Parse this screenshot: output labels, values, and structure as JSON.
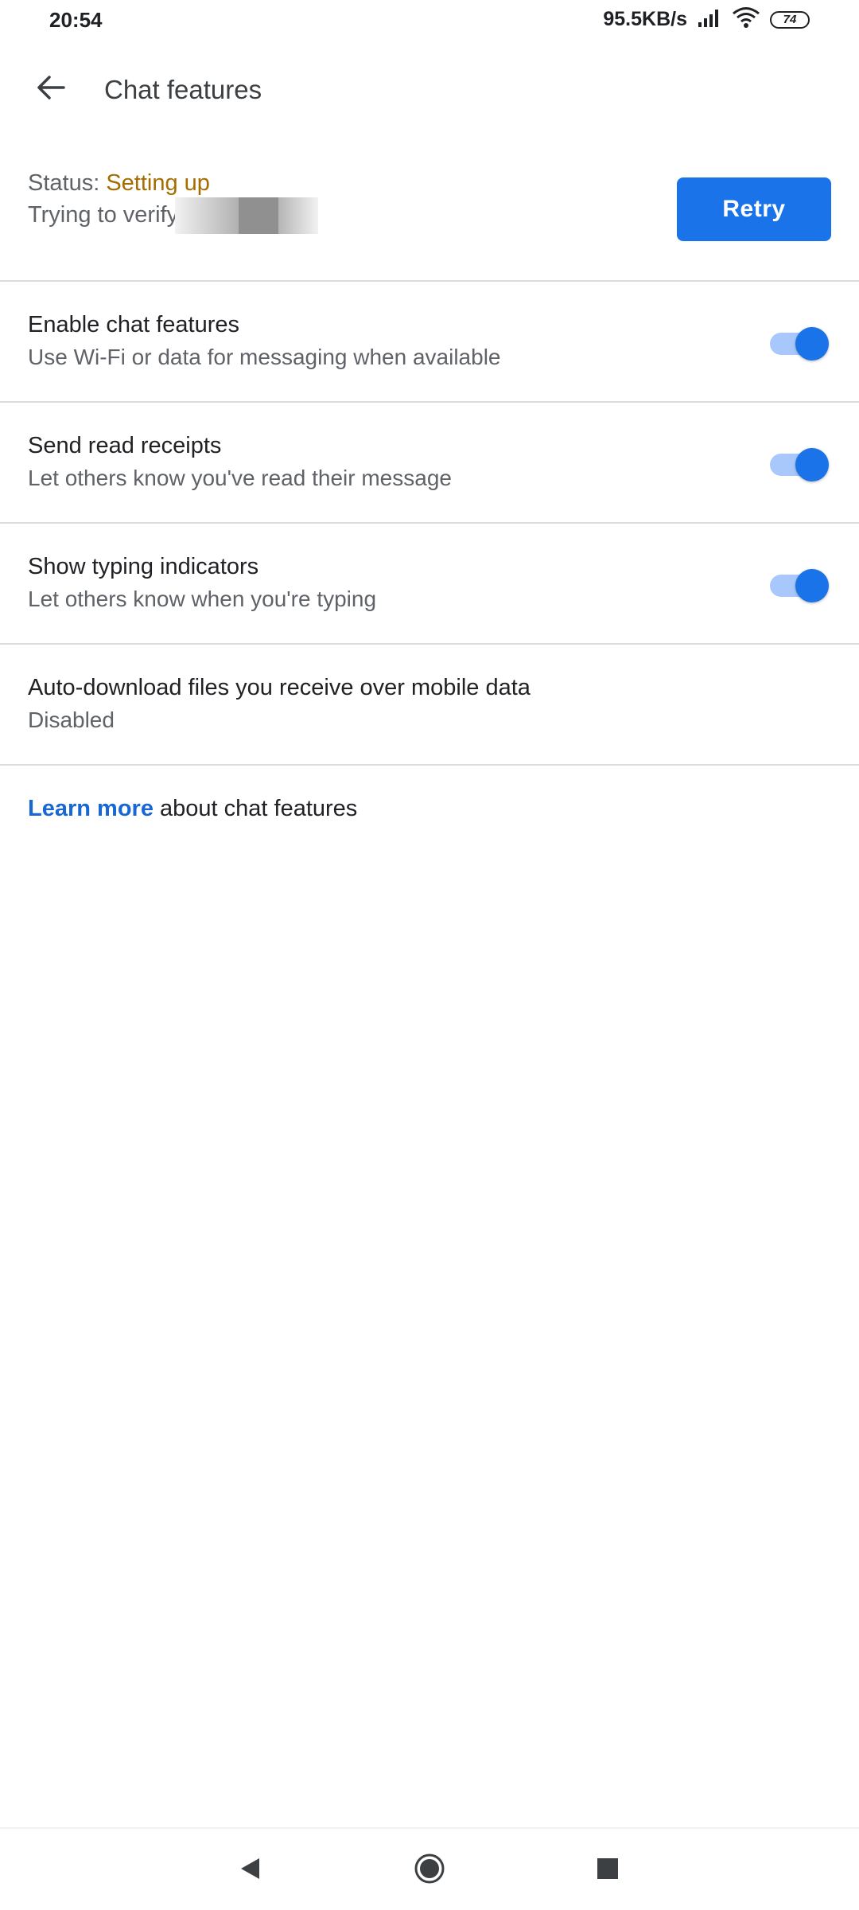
{
  "status_bar": {
    "time": "20:54",
    "net_speed": "95.5KB/s",
    "battery": "74"
  },
  "app_bar": {
    "title": "Chat features",
    "back_icon": "arrow-back-icon"
  },
  "status_section": {
    "status_label": "Status: ",
    "status_value": "Setting up",
    "verify_text": "Trying to verify",
    "retry_label": "Retry"
  },
  "settings": [
    {
      "title": "Enable chat features",
      "subtitle": "Use Wi-Fi or data for messaging when available",
      "toggle_on": true
    },
    {
      "title": "Send read receipts",
      "subtitle": "Let others know you've read their message",
      "toggle_on": true
    },
    {
      "title": "Show typing indicators",
      "subtitle": "Let others know when you're typing",
      "toggle_on": true
    },
    {
      "title": "Auto-download files you receive over mobile data",
      "subtitle": "Disabled"
    }
  ],
  "footer": {
    "learn_more_link": "Learn more",
    "learn_more_text": " about chat features"
  },
  "colors": {
    "accent": "#1a73e8",
    "status_warning": "#a56d00",
    "link": "#1967d2"
  },
  "nav_bar": {
    "back_icon": "nav-back-icon",
    "home_icon": "nav-home-icon",
    "recents_icon": "nav-recents-icon"
  }
}
